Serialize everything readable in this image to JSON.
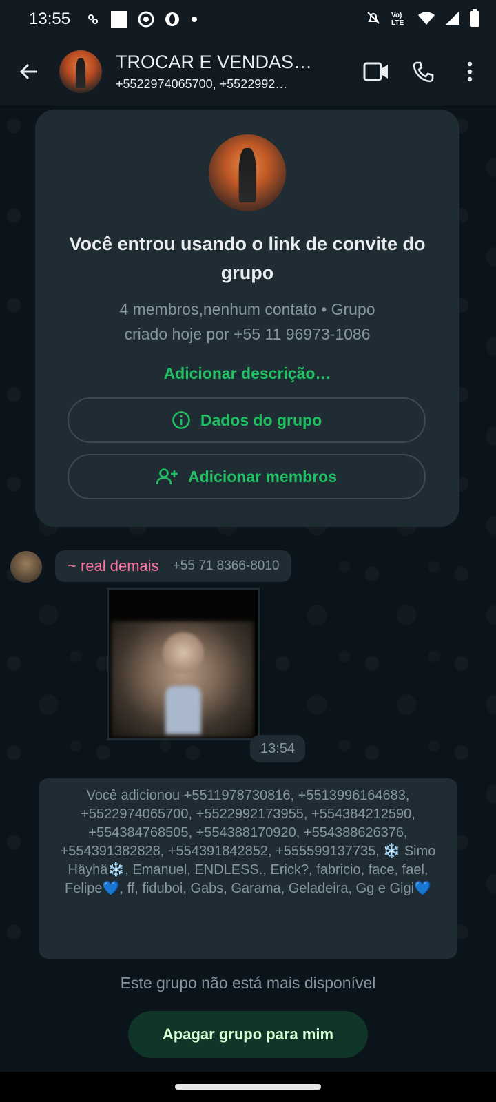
{
  "status_bar": {
    "time": "13:55",
    "network_label": "Vo) LTE",
    "icons": [
      "notification-icon",
      "square-icon",
      "record-icon",
      "opera-icon",
      "dot-icon",
      "mute-icon",
      "volte-icon",
      "wifi-icon",
      "signal-icon",
      "battery-icon"
    ]
  },
  "header": {
    "title": "TROCAR E VENDAS…",
    "subtitle": "+5522974065700, +5522992…",
    "icons": {
      "back": "arrow-left-icon",
      "video": "video-call-icon",
      "call": "phone-icon",
      "menu": "more-vert-icon"
    }
  },
  "info_card": {
    "heading": "Você entrou usando o link de convite do grupo",
    "meta_line1": "4 membros,nenhum contato • Grupo",
    "meta_line2": "criado hoje por +55 11 96973-1086",
    "add_description": "Adicionar descrição…",
    "group_info_label": "Dados do grupo",
    "add_members_label": "Adicionar membros"
  },
  "message": {
    "sender_name": "~ real demais",
    "sender_phone": "+55 71 8366-8010",
    "time": "13:54"
  },
  "system_message": {
    "text": "Você adicionou +5511978730816, +5513996164683, +5522974065700, +5522992173955, +554384212590, +554384768505, +554388170920, +554388626376, +554391382828, +554391842852, +555599137735, ❄️ Simo Häyhä❄️, Emanuel, ENDLESS., Erick?, fabricio, face, fael, Felipe💙, ff, fiduboi, Gabs, Garama, Geladeira, Gg e Gigi💙"
  },
  "footer": {
    "notice": "Este grupo não está mais disponível",
    "delete_button": "Apagar grupo para mim"
  },
  "colors": {
    "background": "#0b141a",
    "bar": "#121b22",
    "card": "#1f2c33",
    "accent_green": "#21c063",
    "sender_pink": "#ff72a1",
    "secondary_text": "#8696a0"
  }
}
